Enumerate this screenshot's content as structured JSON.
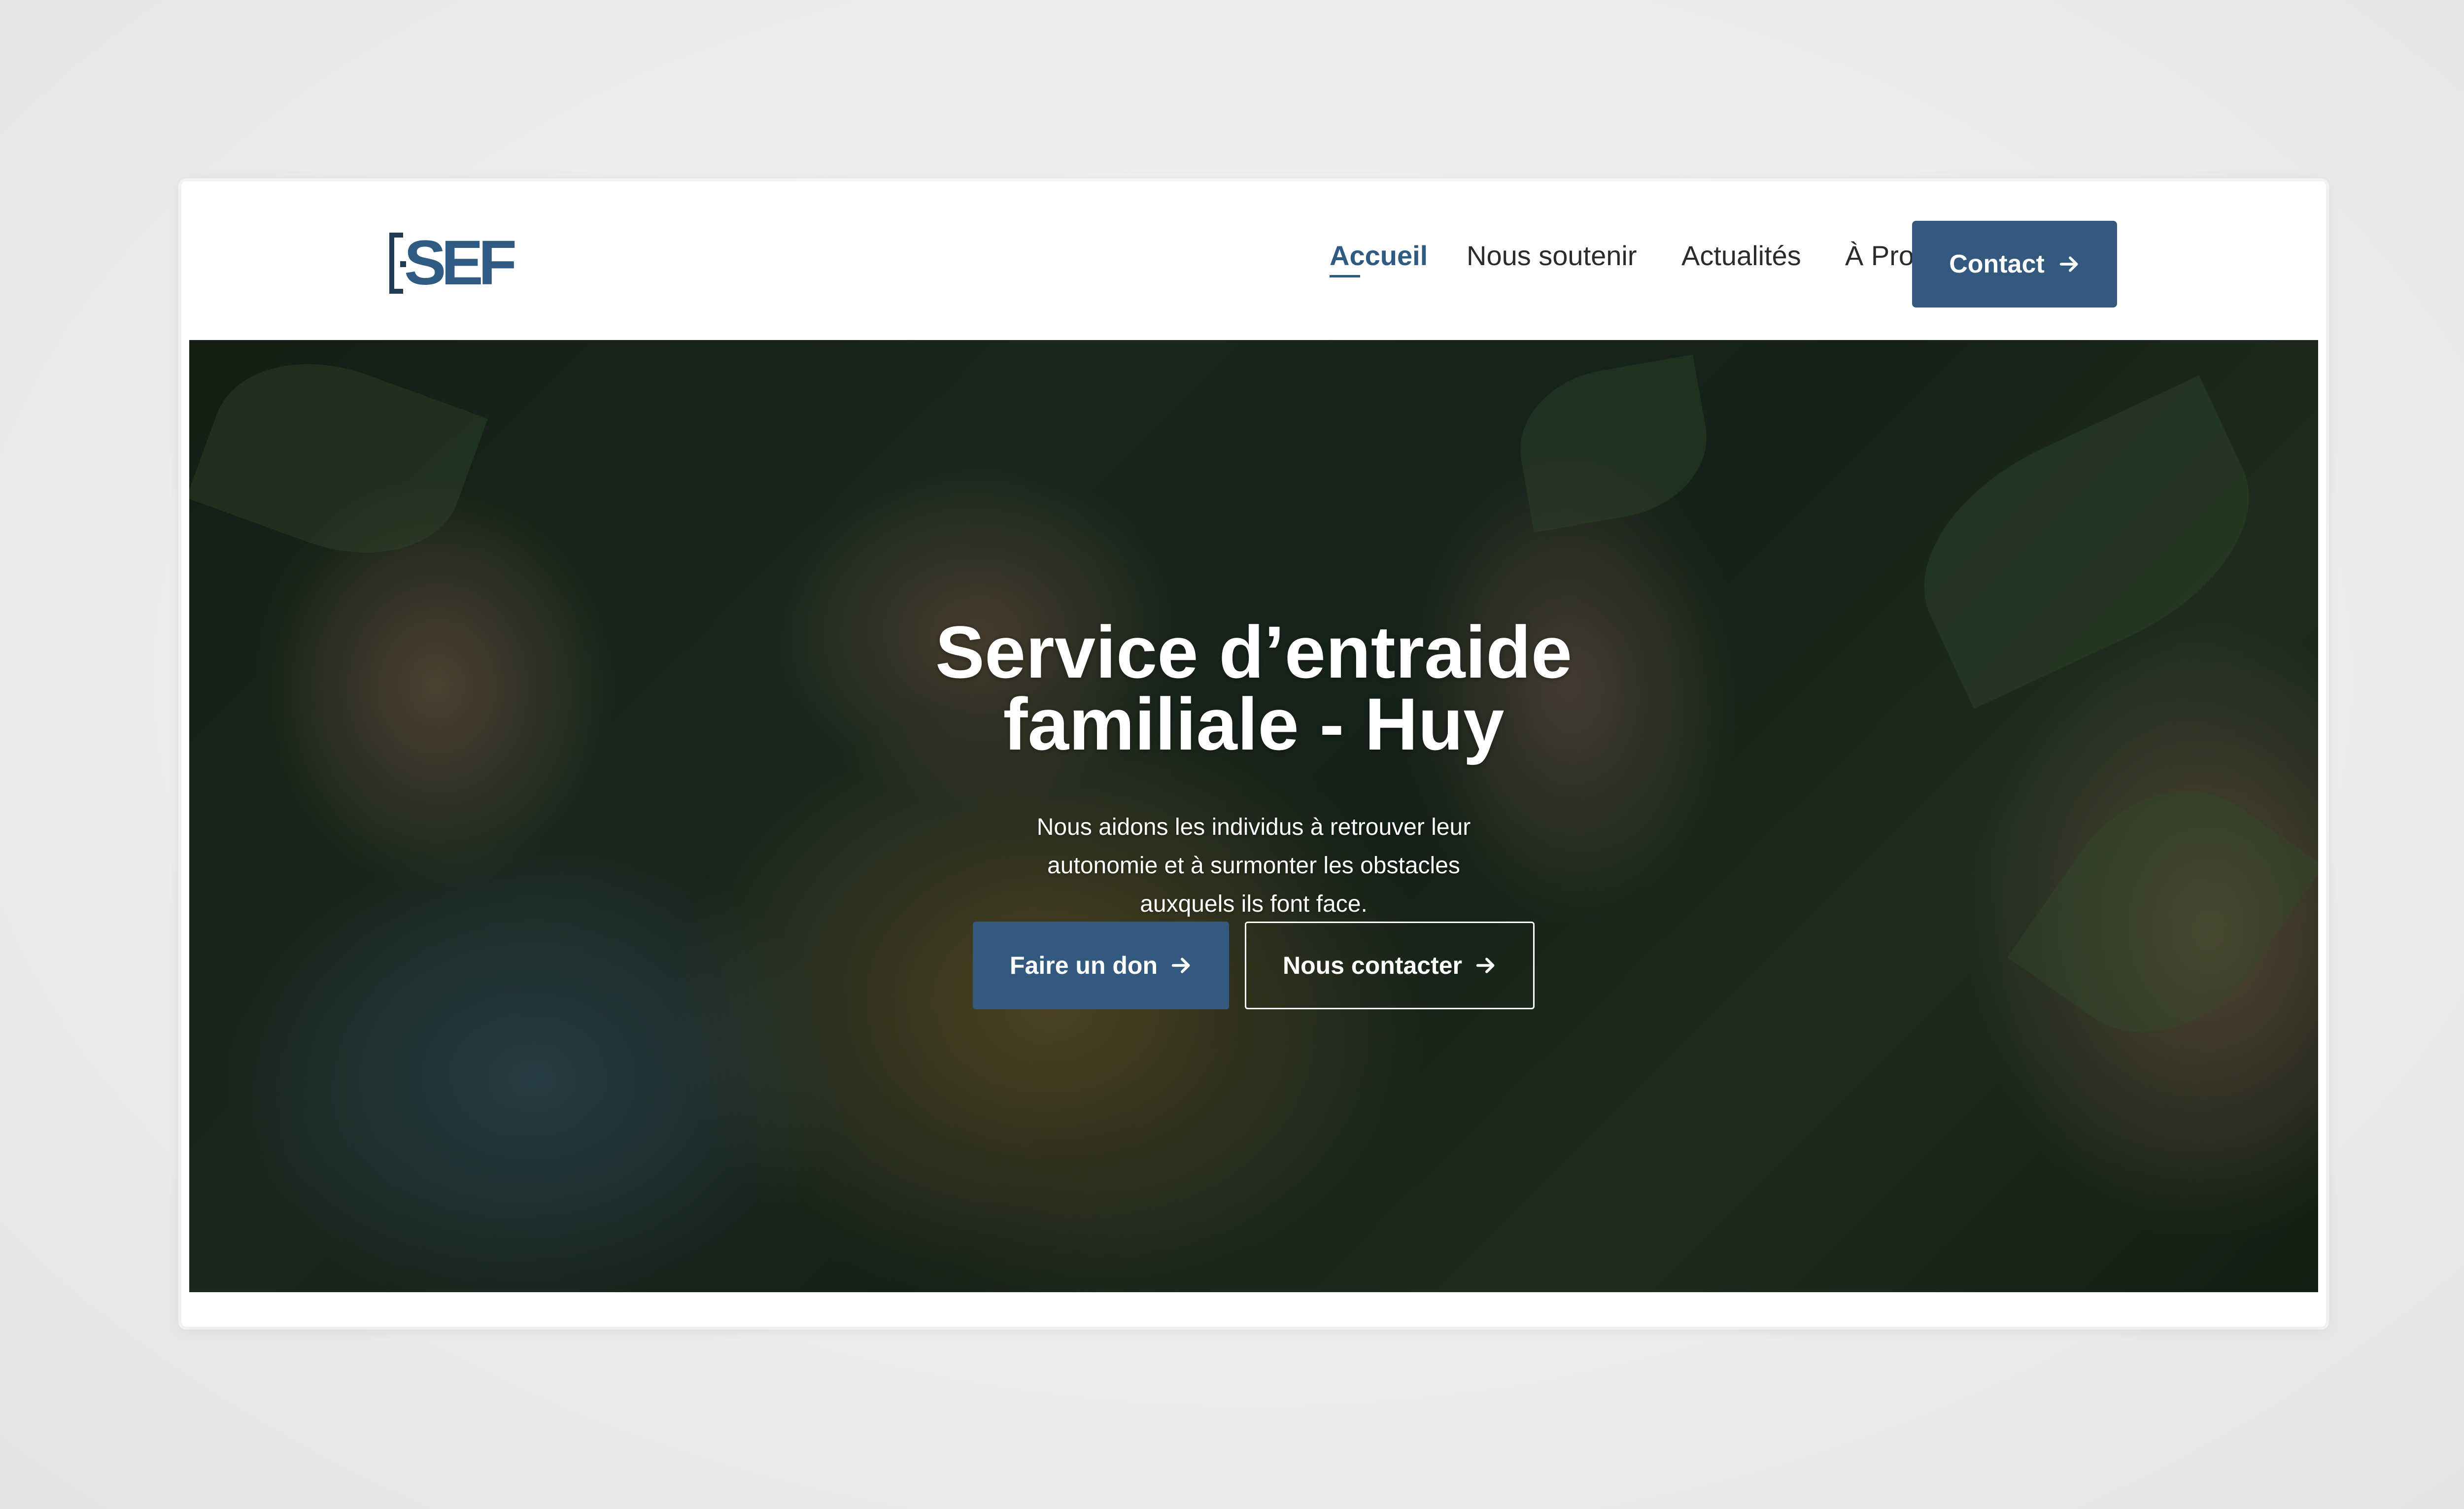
{
  "logo": {
    "text": "SEF"
  },
  "nav": {
    "items": [
      {
        "label": "Accueil",
        "active": true
      },
      {
        "label": "Nous soutenir",
        "active": false
      },
      {
        "label": "Actualités",
        "active": false
      },
      {
        "label": "À Propos",
        "active": false
      }
    ],
    "contact_label": "Contact"
  },
  "hero": {
    "title": "Service d’entraide familiale - Huy",
    "subtitle": "Nous aidons les individus à retrouver leur autonomie et à surmonter les obstacles auxquels ils font face.",
    "primary_button": "Faire un don",
    "secondary_button": "Nous contacter"
  },
  "colors": {
    "brand": "#335a7e",
    "logo_dark": "#233a55",
    "text_dark": "#2b2b2b",
    "white": "#ffffff"
  },
  "icons": {
    "arrow": "arrow-right-icon"
  }
}
